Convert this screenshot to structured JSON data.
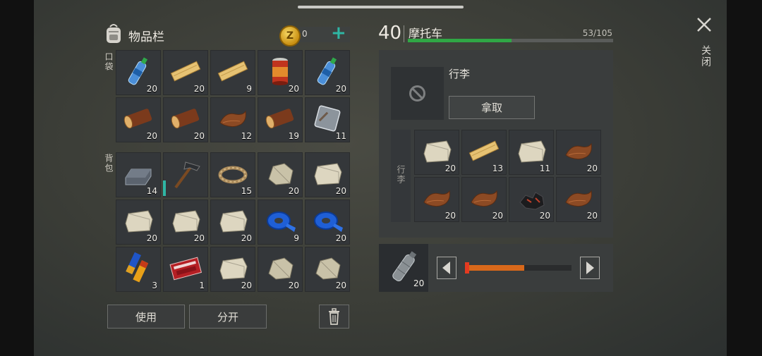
{
  "inventory": {
    "title": "物品栏",
    "coins": "0",
    "pocket_label": "口袋",
    "backpack_label": "背包",
    "pocket": [
      {
        "item": "water-bottle",
        "qty": "20"
      },
      {
        "item": "wood-plank",
        "qty": "20"
      },
      {
        "item": "wood-plank",
        "qty": "9"
      },
      {
        "item": "canned-food",
        "qty": "20"
      },
      {
        "item": "water-bottle",
        "qty": "20"
      },
      {
        "item": "log",
        "qty": "20"
      },
      {
        "item": "log",
        "qty": "20"
      },
      {
        "item": "leather",
        "qty": "12"
      },
      {
        "item": "log",
        "qty": "19"
      },
      {
        "item": "metal-sheet",
        "qty": "11"
      }
    ],
    "backpack": [
      {
        "item": "iron-ingot",
        "qty": "14"
      },
      {
        "item": "hammer",
        "qty": ""
      },
      {
        "item": "rope",
        "qty": "15"
      },
      {
        "item": "stone",
        "qty": "20"
      },
      {
        "item": "limestone",
        "qty": "20"
      },
      {
        "item": "limestone",
        "qty": "20"
      },
      {
        "item": "limestone",
        "qty": "20"
      },
      {
        "item": "limestone",
        "qty": "20"
      },
      {
        "item": "duct-tape",
        "qty": "9"
      },
      {
        "item": "duct-tape",
        "qty": "20"
      },
      {
        "item": "batteries",
        "qty": "3"
      },
      {
        "item": "combat-coupon",
        "qty": "1"
      },
      {
        "item": "limestone",
        "qty": "20"
      },
      {
        "item": "stone",
        "qty": "20"
      },
      {
        "item": "stone",
        "qty": "20"
      }
    ],
    "use_label": "使用",
    "split_label": "分开"
  },
  "vehicle": {
    "level": "40",
    "name": "摩托车",
    "capacity": "53/105",
    "capacity_fraction": 0.505,
    "luggage_title": "行李",
    "take_label": "拿取",
    "luggage_side_label": "行李",
    "luggage": [
      {
        "item": "limestone",
        "qty": "20"
      },
      {
        "item": "wood-plank",
        "qty": "13"
      },
      {
        "item": "limestone",
        "qty": "11"
      },
      {
        "item": "leather",
        "qty": "20"
      },
      {
        "item": "leather",
        "qty": "20"
      },
      {
        "item": "leather",
        "qty": "20"
      },
      {
        "item": "coal",
        "qty": "20"
      },
      {
        "item": "leather",
        "qty": "20"
      }
    ],
    "fuel_item": "empty-bottle",
    "fuel_qty": "20",
    "fuel_fraction": 0.55
  },
  "close_label": "关闭",
  "colors": {
    "accent_green": "#30a745",
    "accent_teal": "#2fb6a4",
    "fuel_orange": "#d8681a"
  }
}
